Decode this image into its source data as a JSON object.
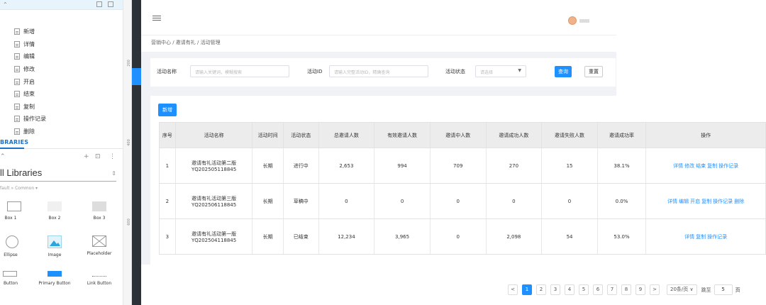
{
  "left_panel": {
    "pages": [
      "新增",
      "详情",
      "编辑",
      "修改",
      "开启",
      "结束",
      "复制",
      "操作记录",
      "删除"
    ],
    "libraries_tab": "BRARIES",
    "library_select": "ll Libraries",
    "library_crumb": "fault » Common ▾",
    "widgets": [
      {
        "label": "Box 1",
        "icon": "box1-shape"
      },
      {
        "label": "Box 2",
        "icon": "box2-shape"
      },
      {
        "label": "Box 3",
        "icon": "box3-shape"
      },
      {
        "label": "Ellipse",
        "icon": "ellipse-shape"
      },
      {
        "label": "Image",
        "icon": "image-shape"
      },
      {
        "label": "Placeholder",
        "icon": "placeholder-shape"
      },
      {
        "label": "Button",
        "icon": "button-shape"
      },
      {
        "label": "Primary Button",
        "icon": "primary-button-shape"
      },
      {
        "label": "Link Button",
        "icon": "link-button-shape"
      }
    ],
    "ruler_ticks": [
      "200",
      "400",
      "600"
    ]
  },
  "breadcrumb": "营销中心 / 邀请有礼 / 活动管理",
  "filter": {
    "name_label": "活动名称",
    "name_placeholder": "请输入关键词，模糊搜索",
    "id_label": "活动ID",
    "id_placeholder": "请输入完整活动ID，精确查询",
    "status_label": "活动状态",
    "status_placeholder": "请选择",
    "query_button": "查询",
    "reset_button": "重置"
  },
  "add_button": "新增",
  "table": {
    "headers": [
      "序号",
      "活动名称",
      "活动时间",
      "活动状态",
      "总邀请人数",
      "有效邀请人数",
      "邀请中人数",
      "邀请成功人数",
      "邀请失败人数",
      "邀请成功率",
      "操作"
    ],
    "rows": [
      {
        "no": "1",
        "name": "邀请有礼活动第二版",
        "code": "YQ202505118845",
        "time": "长期",
        "status": "进行中",
        "total": "2,653",
        "valid": "994",
        "pending": "709",
        "success": "270",
        "fail": "15",
        "rate": "38.1%",
        "ops": [
          "详情",
          "修改",
          "结束",
          "复制",
          "操作记录"
        ]
      },
      {
        "no": "2",
        "name": "邀请有礼活动第三版",
        "code": "YQ202506118845",
        "time": "长期",
        "status": "草稿中",
        "total": "0",
        "valid": "0",
        "pending": "0",
        "success": "0",
        "fail": "0",
        "rate": "0.0%",
        "ops": [
          "详情",
          "编辑",
          "开启",
          "复制",
          "操作记录",
          "删除"
        ]
      },
      {
        "no": "3",
        "name": "邀请有礼活动第一版",
        "code": "YQ202504118845",
        "time": "长期",
        "status": "已结束",
        "total": "12,234",
        "valid": "3,965",
        "pending": "0",
        "success": "2,098",
        "fail": "54",
        "rate": "53.0%",
        "ops": [
          "详情",
          "复制",
          "操作记录"
        ]
      }
    ]
  },
  "pagination": {
    "prev": "<",
    "pages": [
      "1",
      "2",
      "3",
      "4",
      "5",
      "6",
      "7",
      "8",
      "9"
    ],
    "current": "1",
    "next": ">",
    "page_size": "20条/页",
    "jump_label": "跳至",
    "jump_value": "5",
    "page_suffix": "页"
  },
  "colors": {
    "accent": "#1e90ff",
    "sidebar_dark": "#2d3238"
  }
}
